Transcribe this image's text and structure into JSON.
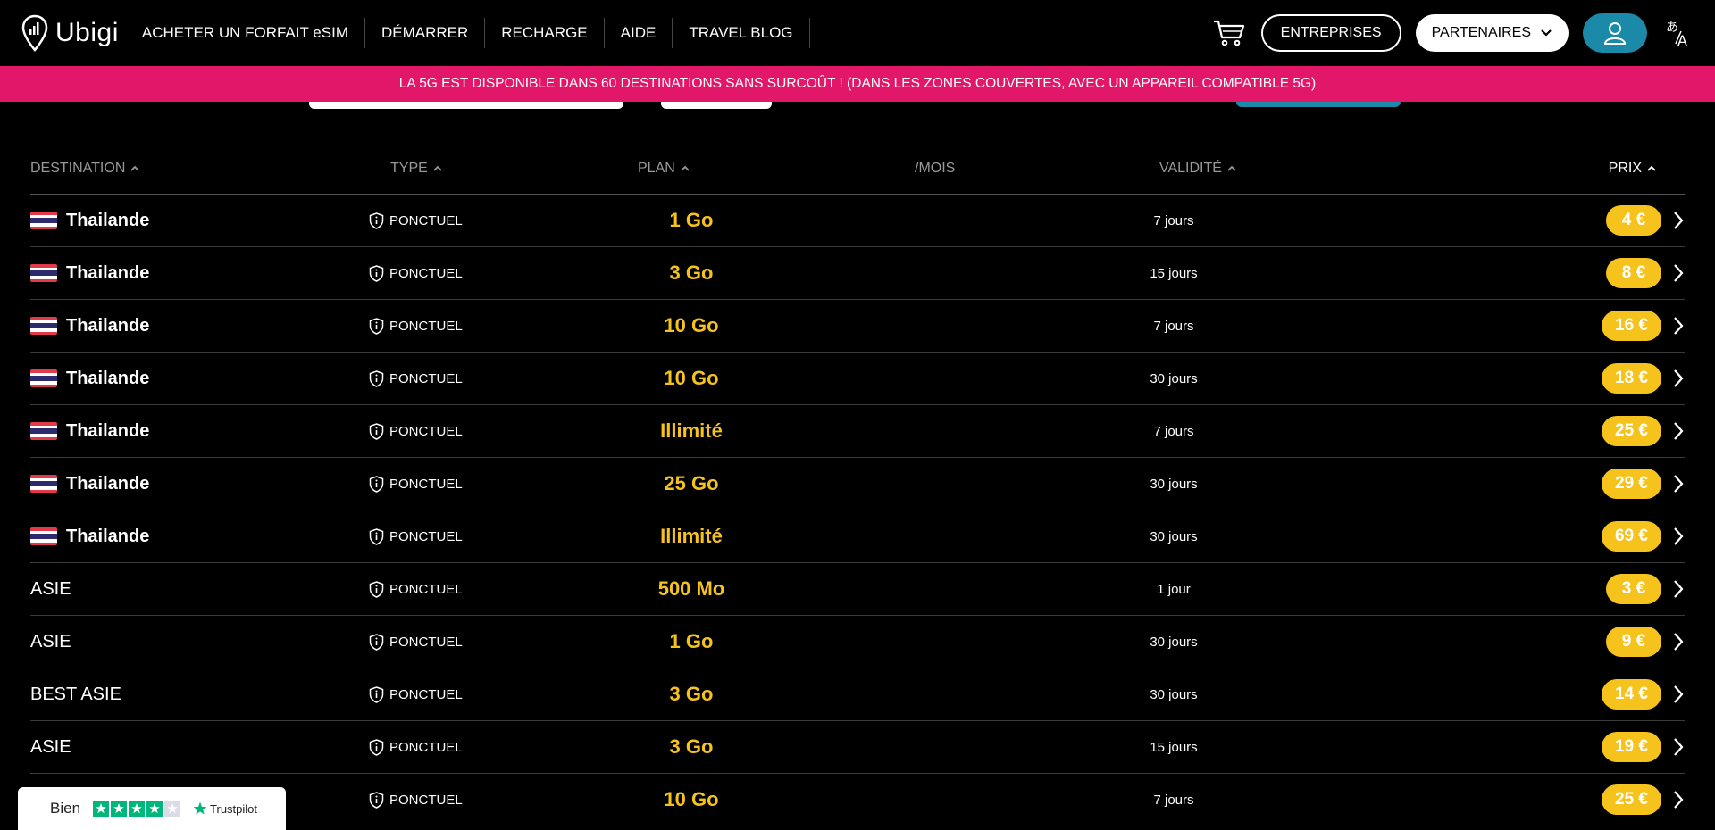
{
  "header": {
    "logo_text": "Ubigi",
    "nav": [
      {
        "label": "ACHETER UN FORFAIT eSIM"
      },
      {
        "label": "DÉMARRER"
      },
      {
        "label": "RECHARGE"
      },
      {
        "label": "AIDE"
      },
      {
        "label": "TRAVEL BLOG"
      }
    ],
    "enterprises_label": "ENTREPRISES",
    "partners_label": "PARTENAIRES",
    "cart_icon": "cart-icon",
    "account_icon": "user-icon",
    "language_icon": "translate-icon",
    "accent_color": "#1a8aa8"
  },
  "banner": {
    "text": "LA 5G EST DISPONIBLE DANS 60 DESTINATIONS SANS SURCOÛT ! (DANS LES ZONES COUVERTES, AVEC UN APPAREIL COMPATIBLE 5G)",
    "color": "#e3176a"
  },
  "table": {
    "headers": {
      "destination": "DESTINATION",
      "type": "TYPE",
      "plan": "PLAN",
      "per_month": "/MOIS",
      "validity": "VALIDITÉ",
      "price": "PRIX"
    },
    "rows": [
      {
        "destination": "Thailande",
        "flag": true,
        "type": "PONCTUEL",
        "plan": "1 Go",
        "validity": "7 jours",
        "price": "4 €"
      },
      {
        "destination": "Thailande",
        "flag": true,
        "type": "PONCTUEL",
        "plan": "3 Go",
        "validity": "15 jours",
        "price": "8 €"
      },
      {
        "destination": "Thailande",
        "flag": true,
        "type": "PONCTUEL",
        "plan": "10 Go",
        "validity": "7 jours",
        "price": "16 €"
      },
      {
        "destination": "Thailande",
        "flag": true,
        "type": "PONCTUEL",
        "plan": "10 Go",
        "validity": "30 jours",
        "price": "18 €"
      },
      {
        "destination": "Thailande",
        "flag": true,
        "type": "PONCTUEL",
        "plan": "Illimité",
        "validity": "7 jours",
        "price": "25 €"
      },
      {
        "destination": "Thailande",
        "flag": true,
        "type": "PONCTUEL",
        "plan": "25 Go",
        "validity": "30 jours",
        "price": "29 €"
      },
      {
        "destination": "Thailande",
        "flag": true,
        "type": "PONCTUEL",
        "plan": "Illimité",
        "validity": "30 jours",
        "price": "69 €"
      },
      {
        "destination": "ASIE",
        "flag": false,
        "type": "PONCTUEL",
        "plan": "500 Mo",
        "validity": "1 jour",
        "price": "3 €"
      },
      {
        "destination": "ASIE",
        "flag": false,
        "type": "PONCTUEL",
        "plan": "1 Go",
        "validity": "30 jours",
        "price": "9 €"
      },
      {
        "destination": "BEST ASIE",
        "flag": false,
        "type": "PONCTUEL",
        "plan": "3 Go",
        "validity": "30 jours",
        "price": "14 €"
      },
      {
        "destination": "ASIE",
        "flag": false,
        "type": "PONCTUEL",
        "plan": "3 Go",
        "validity": "15 jours",
        "price": "19 €"
      },
      {
        "destination": "",
        "flag": false,
        "type": "PONCTUEL",
        "plan": "10 Go",
        "validity": "7 jours",
        "price": "25 €"
      }
    ],
    "plan_color": "#f6c21c",
    "price_color": "#f6c21c"
  },
  "trustpilot": {
    "rating_label": "Bien",
    "brand": "Trustpilot",
    "stars_filled": 4,
    "stars_total": 5,
    "star_color": "#00b67a"
  }
}
